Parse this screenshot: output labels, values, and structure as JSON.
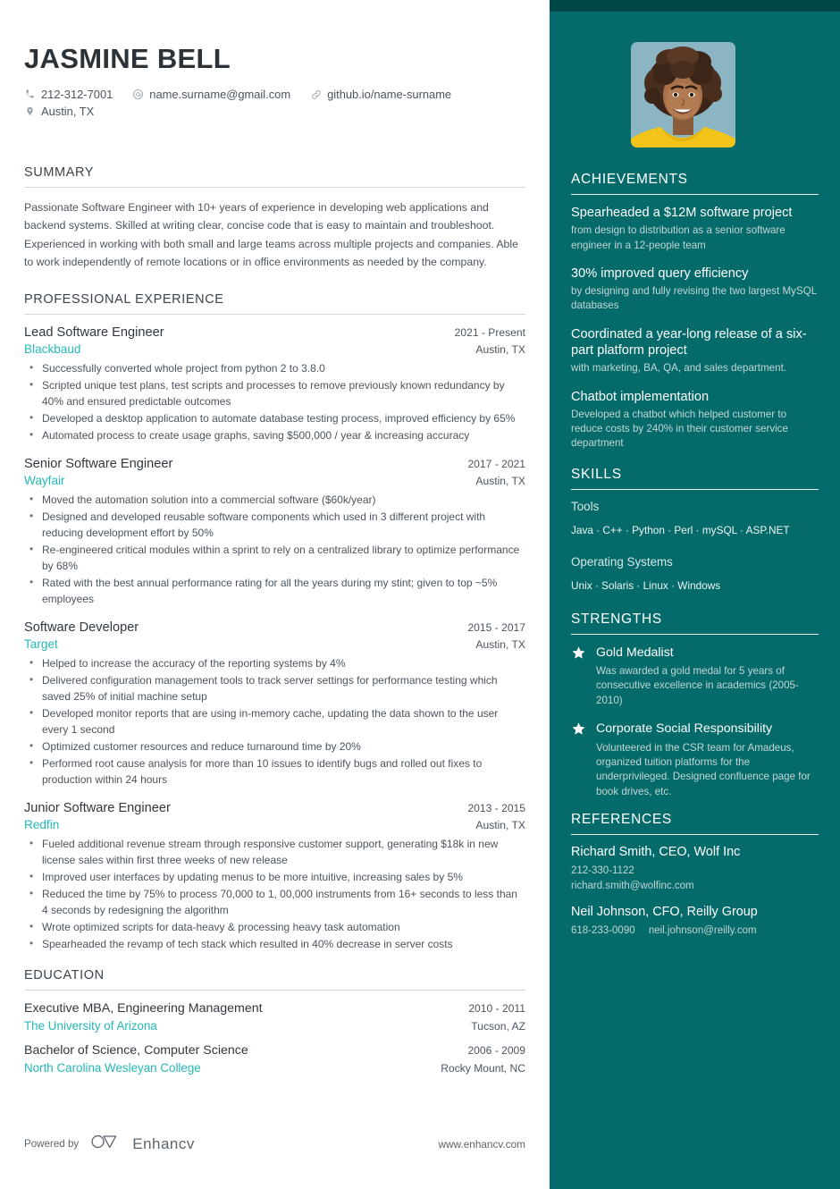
{
  "header": {
    "name": "JASMINE BELL",
    "contacts": [
      {
        "icon": "phone-icon",
        "text": "212-312-7001"
      },
      {
        "icon": "email-icon",
        "text": "name.surname@gmail.com"
      },
      {
        "icon": "link-icon",
        "text": "github.io/name-surname"
      },
      {
        "icon": "location-pin-icon",
        "text": "Austin, TX"
      }
    ]
  },
  "summary": {
    "heading": "SUMMARY",
    "text": "Passionate Software Engineer with 10+ years of experience in developing web applications and backend systems. Skilled at writing clear, concise code that is easy to maintain and troubleshoot. Experienced in working with both small and large teams across multiple projects and companies. Able to work independently of remote locations or in office environments as needed by the company."
  },
  "experience": {
    "heading": "PROFESSIONAL EXPERIENCE",
    "jobs": [
      {
        "title": "Lead Software Engineer",
        "date": "2021 - Present",
        "company": "Blackbaud",
        "location": "Austin, TX",
        "bullets": [
          "Successfully converted whole project from python 2 to 3.8.0",
          "Scripted unique test plans, test scripts and processes to remove previously known redundancy by 40% and ensured predictable outcomes",
          "Developed a desktop application to automate database testing process, improved efficiency by 65%",
          "Automated process to create usage graphs, saving $500,000 / year & increasing accuracy"
        ]
      },
      {
        "title": "Senior Software Engineer",
        "date": "2017 - 2021",
        "company": "Wayfair",
        "location": "Austin, TX",
        "bullets": [
          "Moved the automation solution into a commercial software ($60k/year)",
          "Designed and developed reusable software components which used in 3 different project with reducing development effort by 50%",
          "Re-engineered critical modules within a sprint to rely on a centralized library to optimize performance by 68%",
          "Rated with the best annual performance rating for all the years during my stint; given to top ~5% employees"
        ]
      },
      {
        "title": "Software Developer",
        "date": "2015 - 2017",
        "company": "Target",
        "location": "Austin, TX",
        "bullets": [
          "Helped to increase the accuracy of the reporting systems by 4%",
          "Delivered configuration management tools to track server settings for performance testing which saved 25% of initial machine setup",
          "Developed monitor reports that are using in-memory cache, updating the data shown to the user every 1 second",
          "Optimized customer resources and reduce turnaround time by 20%",
          "Performed root cause analysis for more than 10 issues to identify bugs and rolled out fixes to production within 24 hours"
        ]
      },
      {
        "title": "Junior Software Engineer",
        "date": "2013 - 2015",
        "company": "Redfin",
        "location": "Austin, TX",
        "bullets": [
          "Fueled additional revenue stream through responsive customer support, generating $18k in new license sales within first three weeks of new release",
          "Improved user interfaces by updating menus to be more intuitive, increasing sales by 5%",
          "Reduced the time by 75% to process 70,000 to 1, 00,000 instruments from 16+ seconds to less than 4 seconds by redesigning the algorithm",
          "Wrote optimized scripts for data-heavy & processing heavy task automation",
          "Spearheaded the revamp of tech stack which resulted in 40% decrease in server costs"
        ]
      }
    ]
  },
  "education": {
    "heading": "EDUCATION",
    "entries": [
      {
        "degree": "Executive MBA, Engineering Management",
        "date": "2010 - 2011",
        "school": "The University of Arizona",
        "location": "Tucson, AZ"
      },
      {
        "degree": "Bachelor of Science, Computer Science",
        "date": "2006 - 2009",
        "school": "North Carolina Wesleyan College",
        "location": "Rocky Mount, NC"
      }
    ]
  },
  "achievements": {
    "heading": "ACHIEVEMENTS",
    "items": [
      {
        "title": "Spearheaded a $12M software project",
        "desc": "from design to distribution as a senior software engineer in a 12-people team"
      },
      {
        "title": "30% improved query efficiency",
        "desc": "by designing and fully revising the two largest MySQL databases"
      },
      {
        "title": "Coordinated a year-long release of a six-part platform project",
        "desc": "with marketing, BA, QA, and sales department."
      },
      {
        "title": "Chatbot implementation",
        "desc": "Developed a chatbot which helped customer to reduce costs by 240% in their customer service department"
      }
    ]
  },
  "skills": {
    "heading": "SKILLS",
    "groups": [
      {
        "name": "Tools",
        "list": "Java · C++ · Python · Perl · mySQL · ASP.NET"
      },
      {
        "name": "Operating Systems",
        "list": "Unix ·  Solaris · Linux ·  Windows"
      }
    ]
  },
  "strengths": {
    "heading": "STRENGTHS",
    "items": [
      {
        "icon": "star-icon",
        "title": "Gold Medalist",
        "desc": "Was awarded a gold medal for 5 years of consecutive excellence in academics (2005-2010)"
      },
      {
        "icon": "star-icon",
        "title": "Corporate Social Responsibility",
        "desc": "Volunteered in the CSR team for Amadeus, organized tuition platforms for the underprivileged. Designed confluence page for book drives, etc."
      }
    ]
  },
  "references": {
    "heading": "REFERENCES",
    "items": [
      {
        "name": "Richard Smith, CEO, Wolf Inc",
        "phone": "212-330-1122",
        "email": "richard.smith@wolfinc.com",
        "inline": false
      },
      {
        "name": "Neil Johnson, CFO, Reilly Group",
        "phone": "618-233-0090",
        "email": "neil.johnson@reilly.com",
        "inline": true
      }
    ]
  },
  "footer": {
    "powered_by": "Powered by",
    "brand": "Enhancv",
    "url": "www.enhancv.com"
  },
  "colors": {
    "sidebar_bg": "#056a6a",
    "sidebar_top_band": "#00474a",
    "accent_teal": "#24b8b8",
    "text_dark": "#2f3840",
    "text_body": "#4a5560"
  }
}
